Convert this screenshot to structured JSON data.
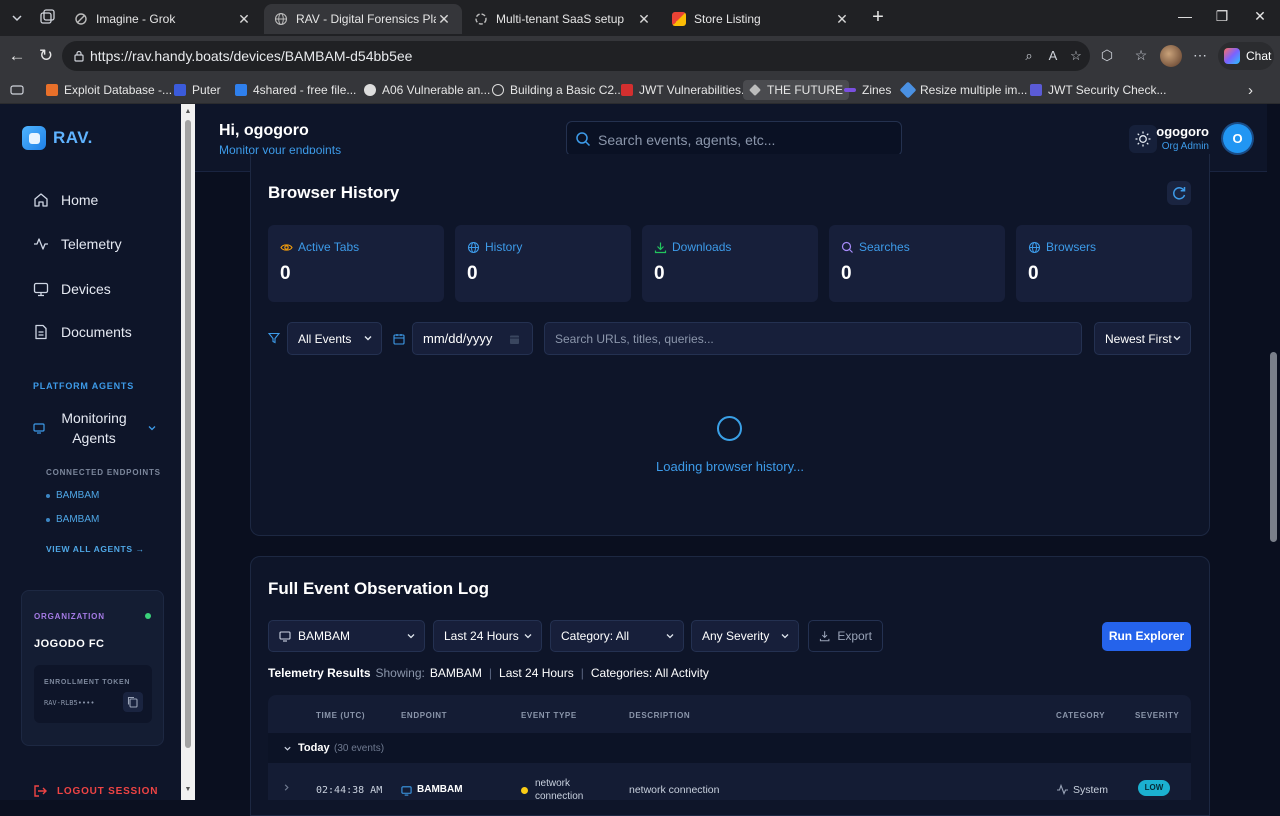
{
  "browser": {
    "tabs": [
      {
        "title": "Imagine - Grok",
        "icon": "grok-icon"
      },
      {
        "title": "RAV - Digital Forensics Platform",
        "icon": "globe-icon"
      },
      {
        "title": "Multi-tenant SaaS setup",
        "icon": "openai-icon"
      },
      {
        "title": "Store Listing",
        "icon": "store-icon"
      }
    ],
    "url": "https://rav.handy.boats/devices/BAMBAM-d54bb5ee",
    "chat_label": "Chat",
    "bookmarks": [
      {
        "label": "Exploit Database -...",
        "color": "#e8702a"
      },
      {
        "label": "Puter",
        "color": "#3b5bdb"
      },
      {
        "label": "4shared - free file...",
        "color": "#2f80ed"
      },
      {
        "label": "A06 Vulnerable an...",
        "color": "#dddddd"
      },
      {
        "label": "Building a Basic C2...",
        "color": "#dddddd"
      },
      {
        "label": "JWT Vulnerabilities...",
        "color": "#d32f2f"
      },
      {
        "label": "THE FUTURE",
        "color": "#bbbbbb"
      },
      {
        "label": "Zines",
        "color": "#7a4fe0"
      },
      {
        "label": "Resize multiple im...",
        "color": "#4a90e2"
      },
      {
        "label": "JWT Security Check...",
        "color": "#5b5bd6"
      }
    ]
  },
  "sidebar": {
    "brand": "RAV.",
    "nav": [
      {
        "label": "Home",
        "icon": "home-icon"
      },
      {
        "label": "Telemetry",
        "icon": "activity-icon"
      },
      {
        "label": "Devices",
        "icon": "monitor-icon"
      },
      {
        "label": "Documents",
        "icon": "document-icon"
      }
    ],
    "section_label": "PLATFORM AGENTS",
    "monitoring_agents": "Monitoring Agents",
    "connected_label": "CONNECTED ENDPOINTS",
    "endpoints": [
      "BAMBAM",
      "BAMBAM"
    ],
    "view_all": "VIEW ALL AGENTS →",
    "org": {
      "label": "ORGANIZATION",
      "name": "JOGODO FC",
      "token_label": "ENROLLMENT TOKEN",
      "token_value": "RAV-RLB5••••"
    },
    "logout": "LOGOUT SESSION"
  },
  "header": {
    "greeting": "Hi, ogogoro",
    "subtitle": "Monitor your endpoints",
    "search_placeholder": "Search events, agents, etc...",
    "user_name": "ogogoro",
    "user_role": "Org Admin",
    "user_initial": "O"
  },
  "browser_history": {
    "title": "Browser History",
    "stats": [
      {
        "label": "Active Tabs",
        "value": "0",
        "color": "#f59e0b",
        "icon": "eye-icon"
      },
      {
        "label": "History",
        "value": "0",
        "color": "#3d9be9",
        "icon": "globe-icon"
      },
      {
        "label": "Downloads",
        "value": "0",
        "color": "#22c55e",
        "icon": "download-icon"
      },
      {
        "label": "Searches",
        "value": "0",
        "color": "#a78bfa",
        "icon": "search-icon"
      },
      {
        "label": "Browsers",
        "value": "0",
        "color": "#3d9be9",
        "icon": "globe-icon"
      }
    ],
    "event_filter": "All Events",
    "date_placeholder": "mm/dd/yyyy",
    "search_placeholder": "Search URLs, titles, queries...",
    "sort": "Newest First",
    "loading": "Loading browser history..."
  },
  "event_log": {
    "title": "Full Event Observation Log",
    "endpoint_filter": "BAMBAM",
    "time_filter": "Last 24 Hours",
    "category_filter": "Category: All",
    "severity_filter": "Any Severity",
    "export_label": "Export",
    "run_label": "Run Explorer",
    "results_title": "Telemetry Results",
    "showing_label": "Showing:",
    "showing_endpoint": "BAMBAM",
    "showing_time": "Last 24 Hours",
    "showing_categories": "Categories: All Activity",
    "columns": [
      "TIME (UTC)",
      "ENDPOINT",
      "EVENT TYPE",
      "DESCRIPTION",
      "CATEGORY",
      "SEVERITY"
    ],
    "group_label": "Today",
    "group_count": "(30 events)",
    "rows": [
      {
        "time": "02:44:38 AM",
        "endpoint": "BAMBAM",
        "event_type": "network connection",
        "description": "network connection",
        "category": "System",
        "severity": "LOW"
      }
    ]
  }
}
